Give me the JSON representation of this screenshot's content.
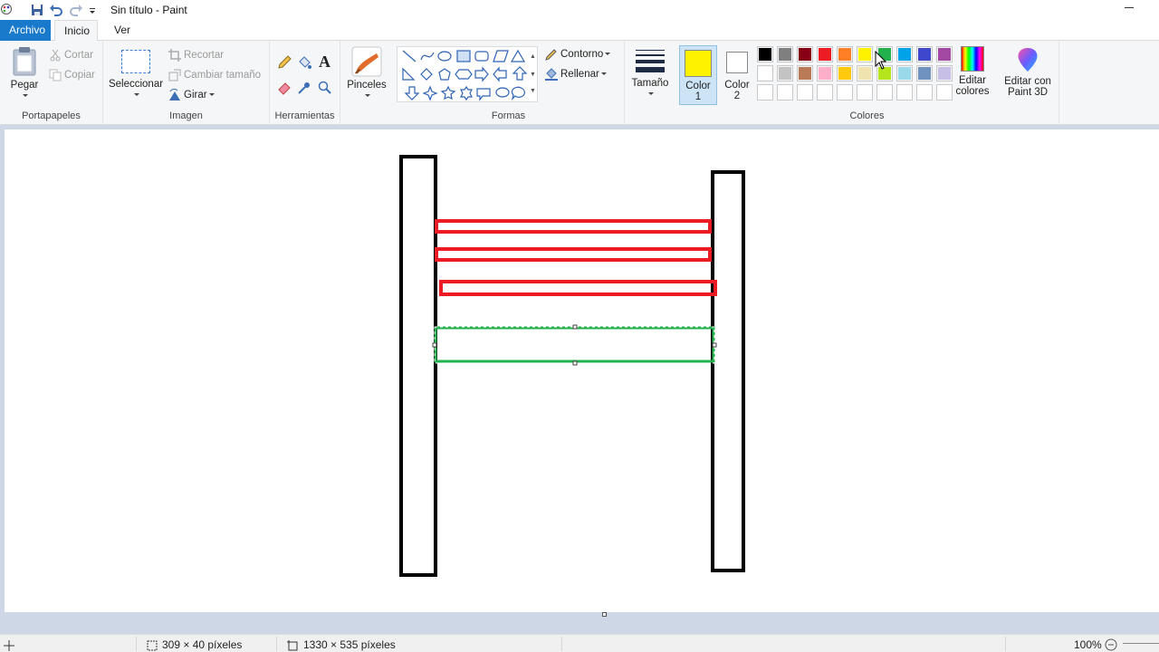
{
  "window": {
    "title": "Sin título - Paint"
  },
  "tabs": {
    "file": "Archivo",
    "home": "Inicio",
    "view": "Ver"
  },
  "clipboard": {
    "paste": "Pegar",
    "cut": "Cortar",
    "copy": "Copiar",
    "label": "Portapapeles"
  },
  "image": {
    "select": "Seleccionar",
    "crop": "Recortar",
    "resize": "Cambiar tamaño",
    "rotate": "Girar",
    "label": "Imagen"
  },
  "tools": {
    "label": "Herramientas"
  },
  "brushes": {
    "label": "Pinceles"
  },
  "shapes": {
    "outline": "Contorno",
    "fill": "Rellenar",
    "label": "Formas"
  },
  "size": {
    "label": "Tamaño"
  },
  "colors": {
    "color1_label": "Color",
    "color1_num": "1",
    "color2_label": "Color",
    "color2_num": "2",
    "color1_value": "#fff200",
    "color2_value": "#ffffff",
    "edit_colors_line1": "Editar",
    "edit_colors_line2": "colores",
    "paint3d_line1": "Editar con",
    "paint3d_line2": "Paint 3D",
    "label": "Colores",
    "row1": [
      "#000000",
      "#7f7f7f",
      "#880015",
      "#ed1c24",
      "#ff7f27",
      "#fff200",
      "#22b14c",
      "#00a2e8",
      "#3f48cc",
      "#a349a4"
    ],
    "row2": [
      "#ffffff",
      "#c3c3c3",
      "#b97a57",
      "#ffaec9",
      "#ffc90e",
      "#efe4b0",
      "#b5e61d",
      "#99d9ea",
      "#7092be",
      "#c8bfe7"
    ]
  },
  "status": {
    "selection_size": "309 × 40 píxeles",
    "canvas_size": "1330 × 535 píxeles",
    "zoom": "100%"
  },
  "drawing": {
    "post_color": "#000000",
    "rail_color": "#ed1c24",
    "selected_rail_color": "#22b14c"
  }
}
